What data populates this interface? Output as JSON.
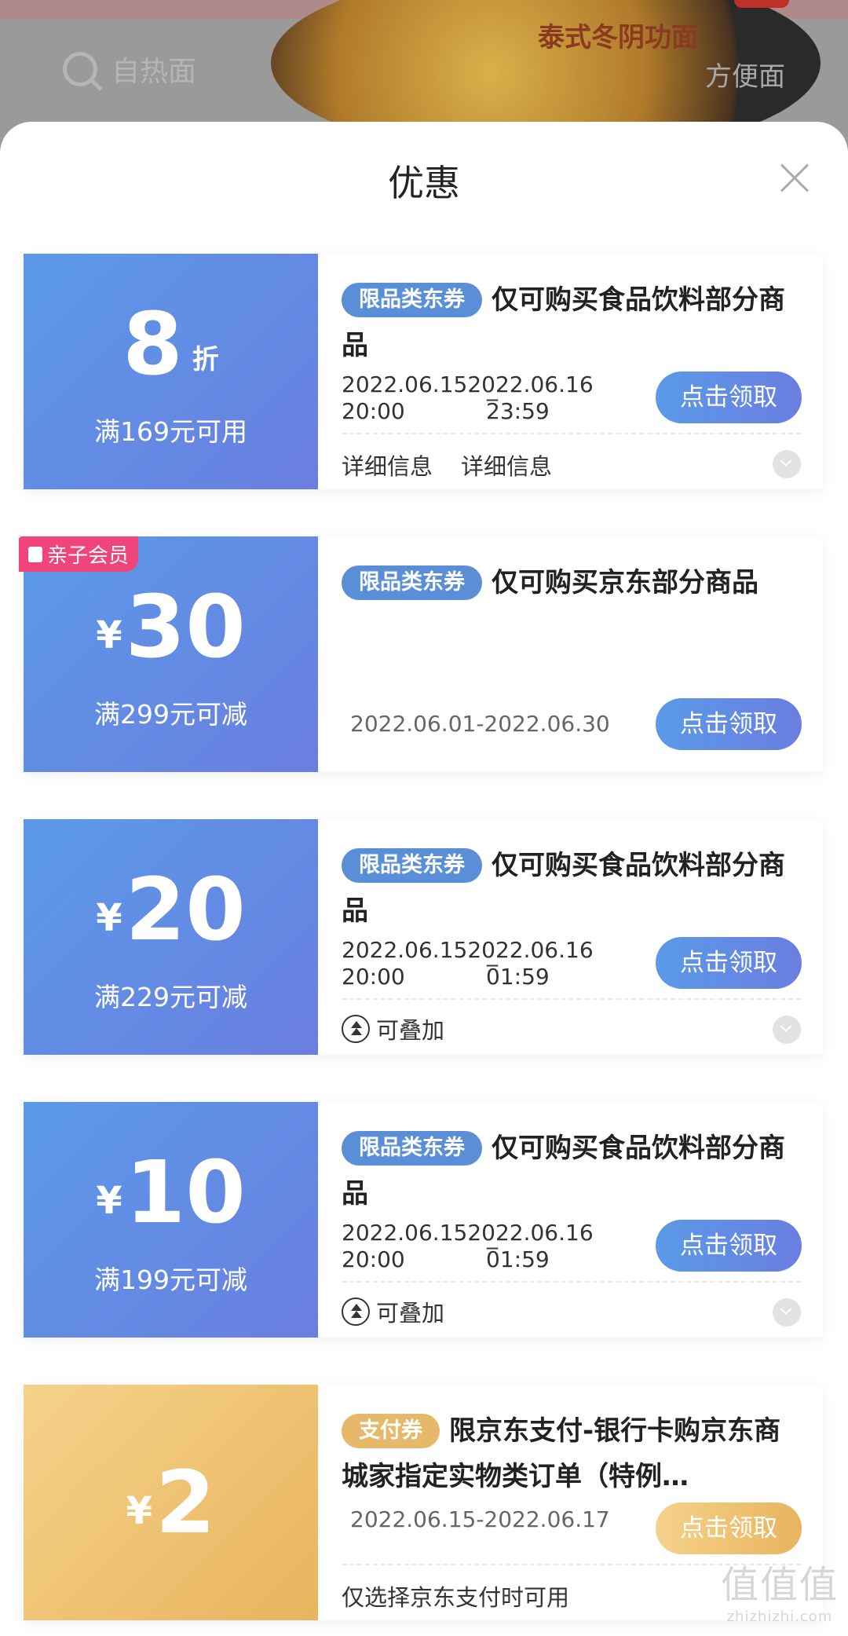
{
  "background": {
    "search_placeholder": "自热面",
    "right_text": "方便面",
    "product_text": "泰式冬阴功面"
  },
  "sheet": {
    "title": "优惠"
  },
  "coupons": [
    {
      "amount": "8",
      "suffix": "折",
      "condition": "满169元可用",
      "tag": "限品类东券",
      "desc": "仅可购买食品饮料部分商品",
      "date_start": "2022.06.15",
      "sep": "_",
      "date_end": "2022.06.16",
      "time_start": "20:00",
      "time_end": "23:59",
      "button": "点击领取",
      "detail_1": "详细信息",
      "detail_2": "详细信息"
    },
    {
      "member_badge": "亲子会员",
      "currency": "¥",
      "amount": "30",
      "condition": "满299元可减",
      "tag": "限品类东券",
      "desc": "仅可购买京东部分商品",
      "range": "2022.06.01-2022.06.30",
      "button": "点击领取"
    },
    {
      "currency": "¥",
      "amount": "20",
      "condition": "满229元可减",
      "tag": "限品类东券",
      "desc": "仅可购买食品饮料部分商品",
      "date_start": "2022.06.15",
      "sep": "_",
      "date_end": "2022.06.16",
      "time_start": "20:00",
      "time_end": "01:59",
      "button": "点击领取",
      "stackable": "可叠加"
    },
    {
      "currency": "¥",
      "amount": "10",
      "condition": "满199元可减",
      "tag": "限品类东券",
      "desc": "仅可购买食品饮料部分商品",
      "date_start": "2022.06.15",
      "sep": "_",
      "date_end": "2022.06.16",
      "time_start": "20:00",
      "time_end": "01:59",
      "button": "点击领取",
      "stackable": "可叠加"
    },
    {
      "currency": "¥",
      "amount": "2",
      "tag": "支付券",
      "desc": "限京东支付-银行卡购京东商城家指定实物类订单（特例…",
      "range": "2022.06.15-2022.06.17",
      "button": "点击领取",
      "note": "仅选择京东支付时可用"
    }
  ],
  "watermark": {
    "big": "值值值",
    "small": "zhizhizhi.com"
  },
  "colors": {
    "blue_start": "#5b9ae8",
    "blue_end": "#6a7ee0",
    "gold_start": "#f5d28a",
    "gold_end": "#e8b45e",
    "member_pink": "#f0457a"
  }
}
